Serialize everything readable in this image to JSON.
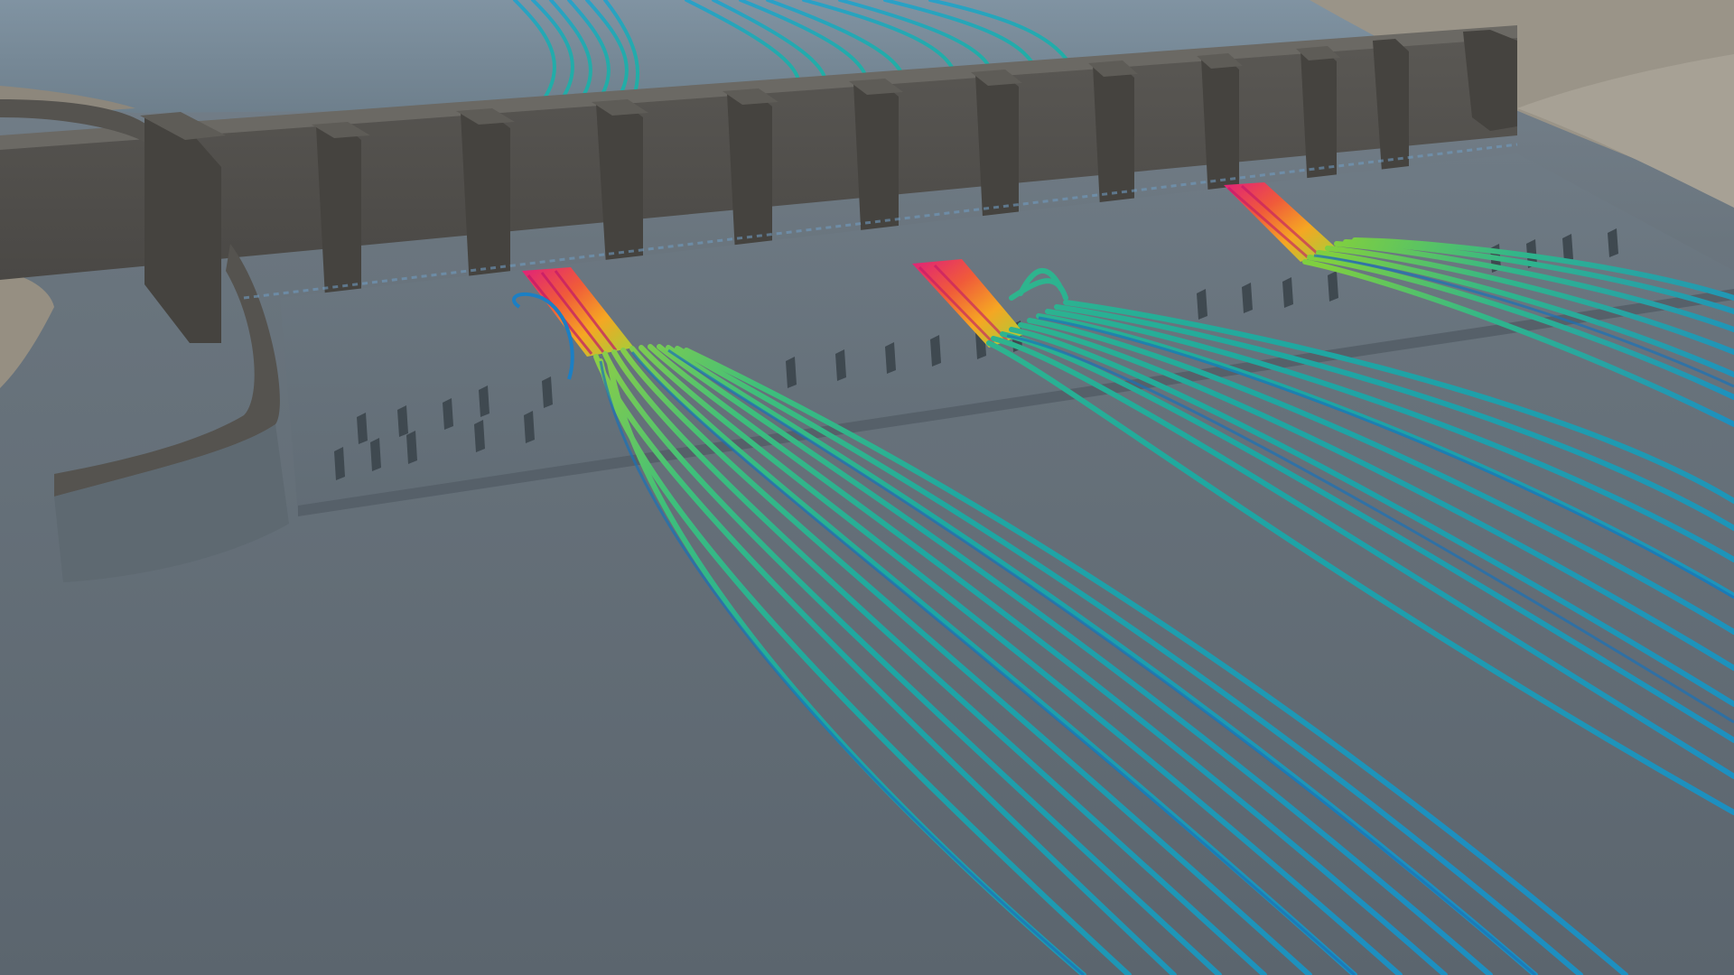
{
  "scene": {
    "subject": "spillway-dam-flow-streamlines",
    "colors": {
      "water_surface": "#667079",
      "water_far": "#7a8794",
      "sand": "#9a9488",
      "dam_wall": "#4f4d4a",
      "dam_wall_light": "#5e5c58",
      "pier": "#46443f",
      "apron": "#6b7680",
      "baffle_block": "#3f4950"
    },
    "flow_colormap": [
      "#e0207a",
      "#f05a3a",
      "#f5a623",
      "#9fd23a",
      "#2fb58c",
      "#1ea0a8",
      "#1c7fc4"
    ],
    "open_gates": 3,
    "dam_bays": 12
  }
}
